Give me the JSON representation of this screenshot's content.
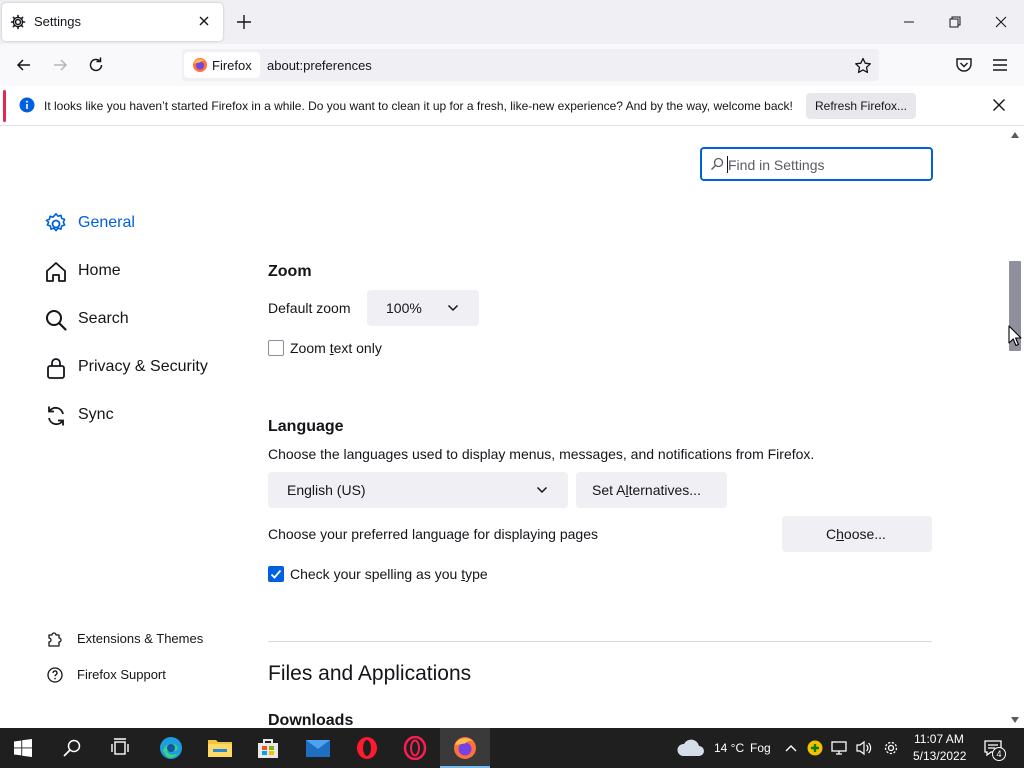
{
  "browser": {
    "tab_title": "Settings",
    "identity_label": "Firefox",
    "url": "about:preferences"
  },
  "notification": {
    "message": "It looks like you haven’t started Firefox in a while. Do you want to clean it up for a fresh, like-new experience? And by the way, welcome back!",
    "button_label": "Refresh Firefox..."
  },
  "search": {
    "placeholder": "Find in Settings"
  },
  "sidebar": {
    "items": [
      {
        "label": "General",
        "icon": "gear-icon",
        "selected": true
      },
      {
        "label": "Home",
        "icon": "home-icon"
      },
      {
        "label": "Search",
        "icon": "search-icon"
      },
      {
        "label": "Privacy & Security",
        "icon": "lock-icon"
      },
      {
        "label": "Sync",
        "icon": "sync-icon"
      }
    ],
    "footer": [
      {
        "label": "Extensions & Themes",
        "icon": "puzzle-icon"
      },
      {
        "label": "Firefox Support",
        "icon": "help-icon"
      }
    ]
  },
  "zoom": {
    "heading": "Zoom",
    "default_label": "Default zoom",
    "value": "100%",
    "text_only_label_pre": "Zoom ",
    "text_only_label_key": "t",
    "text_only_label_post": "ext only",
    "text_only_checked": false
  },
  "language": {
    "heading": "Language",
    "description": "Choose the languages used to display menus, messages, and notifications from Firefox.",
    "selected": "English (US)",
    "alternatives_pre": "Set A",
    "alternatives_key": "l",
    "alternatives_post": "ternatives...",
    "pages_label": "Choose your preferred language for displaying pages",
    "choose_pre": "C",
    "choose_key": "h",
    "choose_post": "oose...",
    "spell_pre": "Check your spelling as you ",
    "spell_key": "t",
    "spell_post": "ype",
    "spell_checked": true
  },
  "files": {
    "heading": "Files and Applications",
    "downloads_heading": "Downloads"
  },
  "taskbar": {
    "weather_temp": "14 °C",
    "weather_desc": "Fog",
    "time": "11:07 AM",
    "date": "5/13/2022",
    "notifications_count": "4"
  },
  "colors": {
    "accent": "#0061e0",
    "notice_bar": "#e22850",
    "taskbar": "#1f1f1f"
  }
}
